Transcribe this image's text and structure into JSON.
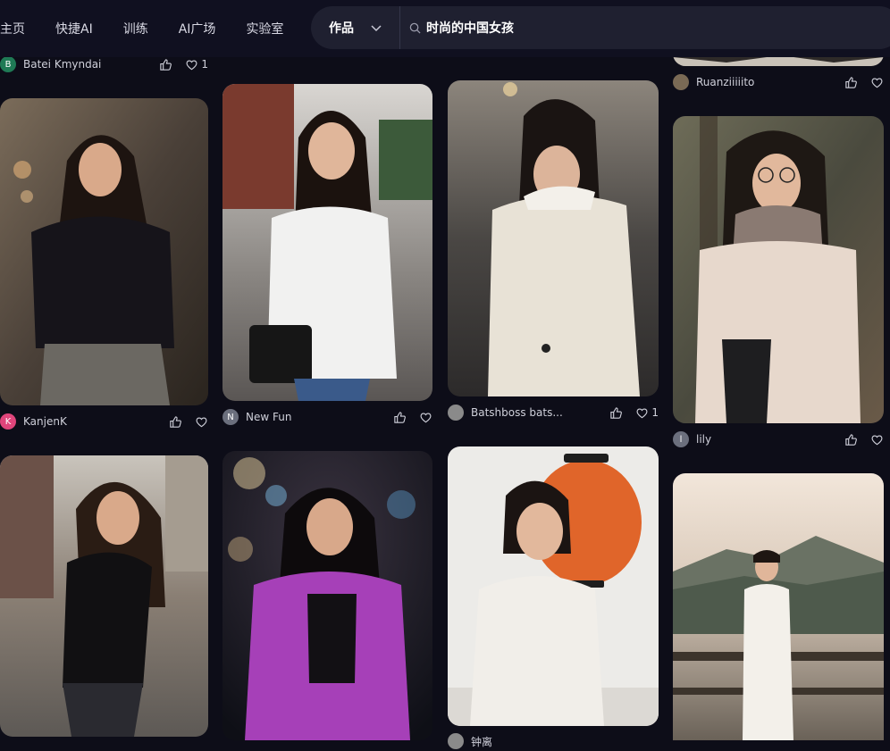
{
  "nav": {
    "items": [
      "主页",
      "快捷AI",
      "训练",
      "AI广场",
      "实验室"
    ]
  },
  "search": {
    "category": "作品",
    "value": "时尚的中国女孩"
  },
  "cards": {
    "c0_0": {
      "user": "Batei Kmyndai",
      "avatar_letter": "B",
      "avatar_color": "#1f7a55",
      "likes": "1"
    },
    "c0_1": {
      "user": "KanjenK",
      "avatar_letter": "K",
      "avatar_color": "#e0457b",
      "likes": ""
    },
    "c1_0": {
      "user": "New Fun",
      "avatar_letter": "N",
      "avatar_color": "#6b6f7d",
      "likes": ""
    },
    "c2_0": {
      "user": "Batshboss bats...",
      "avatar_letter": "",
      "avatar_color": "#8a8a8a",
      "likes": "1"
    },
    "c2_1": {
      "user": "钟离",
      "avatar_letter": "",
      "avatar_color": "#8a8a8a",
      "likes": ""
    },
    "c3_0": {
      "user": "Ruanziiiiito",
      "avatar_letter": "",
      "avatar_color": "#7a6a55",
      "likes": ""
    },
    "c3_1": {
      "user": "lily",
      "avatar_letter": "l",
      "avatar_color": "#6b6f7d",
      "likes": ""
    }
  }
}
